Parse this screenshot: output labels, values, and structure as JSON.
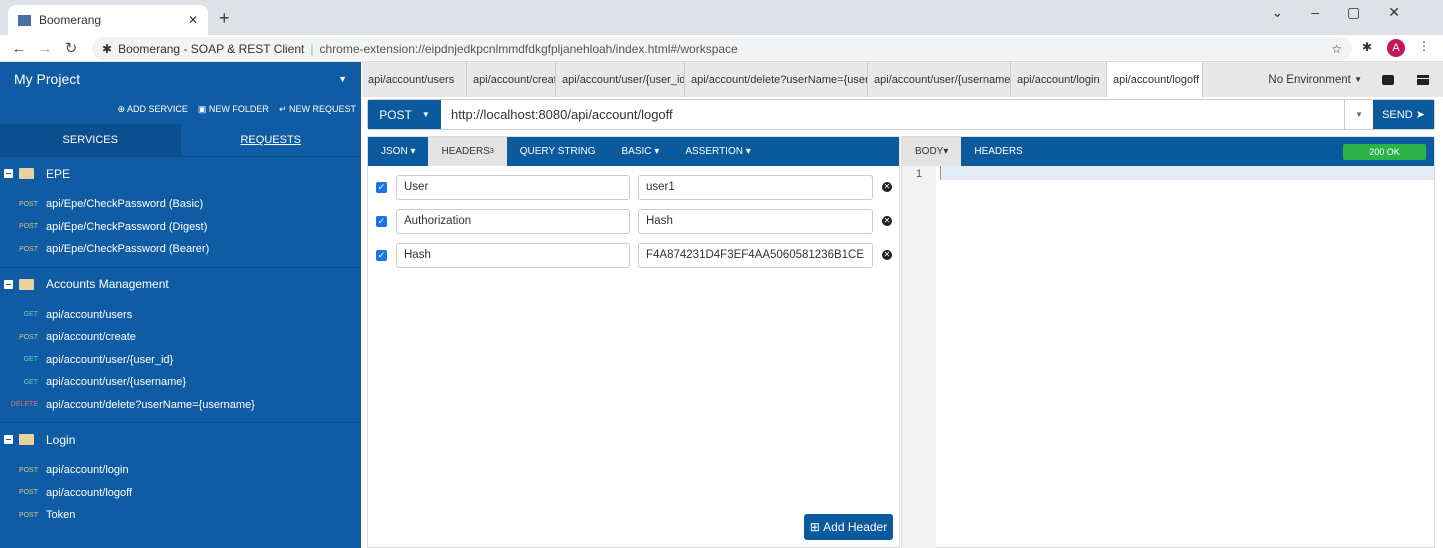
{
  "browser": {
    "tab_title": "Boomerang",
    "page_title": "Boomerang - SOAP & REST Client",
    "url": "chrome-extension://eipdnjedkpcnlmmdfdkgfpljanehloah/index.html#/workspace",
    "avatar": "A"
  },
  "sidebar": {
    "project": "My Project",
    "actions": [
      "ADD SERVICE",
      "NEW FOLDER",
      "NEW REQUEST"
    ],
    "tabs": [
      "SERVICES",
      "REQUESTS"
    ],
    "folders": [
      {
        "name": "EPE",
        "items": [
          {
            "method": "POST",
            "label": "api/Epe/CheckPassword (Basic)"
          },
          {
            "method": "POST",
            "label": "api/Epe/CheckPassword (Digest)"
          },
          {
            "method": "POST",
            "label": "api/Epe/CheckPassword (Bearer)"
          }
        ]
      },
      {
        "name": "Accounts Management",
        "items": [
          {
            "method": "GET",
            "label": "api/account/users"
          },
          {
            "method": "POST",
            "label": "api/account/create"
          },
          {
            "method": "GET",
            "label": "api/account/user/{user_id}"
          },
          {
            "method": "GET",
            "label": "api/account/user/{username}"
          },
          {
            "method": "DELETE",
            "label": "api/account/delete?userName={username}"
          }
        ]
      },
      {
        "name": "Login",
        "items": [
          {
            "method": "POST",
            "label": "api/account/login"
          },
          {
            "method": "POST",
            "label": "api/account/logoff"
          },
          {
            "method": "POST",
            "label": "Token"
          }
        ]
      }
    ]
  },
  "request_tabs": [
    "api/account/users",
    "api/account/create",
    "api/account/user/{user_id}",
    "api/account/delete?userName={username}",
    "api/account/user/{username}",
    "api/account/login",
    "api/account/logoff"
  ],
  "environment": "No Environment",
  "request": {
    "method": "POST",
    "url": "http://localhost:8080/api/account/logoff",
    "send": "SEND"
  },
  "req_tabs": {
    "json": "JSON",
    "headers": "HEADERS",
    "headers_count": "3",
    "query": "QUERY STRING",
    "basic": "BASIC",
    "assertion": "ASSERTION"
  },
  "headers": [
    {
      "key": "User",
      "value": "user1"
    },
    {
      "key": "Authorization",
      "value": "Hash"
    },
    {
      "key": "Hash",
      "value": "F4A874231D4F3EF4AA5060581236B1CE"
    }
  ],
  "add_header": "Add Header",
  "response": {
    "body": "BODY",
    "headers": "HEADERS",
    "status": "200 OK",
    "line": "1"
  }
}
